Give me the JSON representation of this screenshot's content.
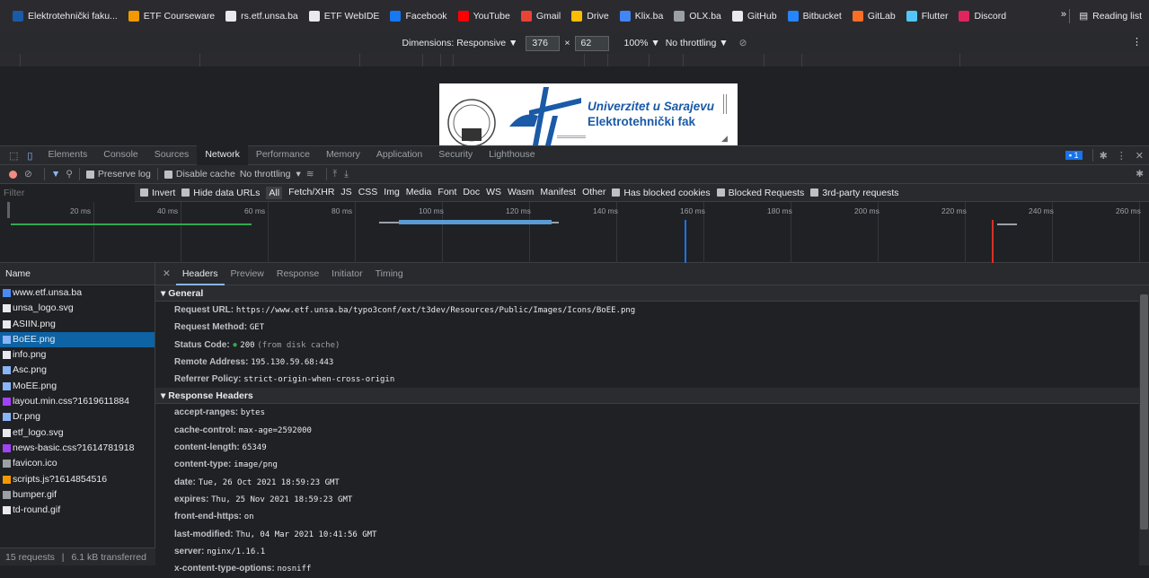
{
  "bookmarks": [
    {
      "label": "Elektrotehnički faku...",
      "color": "#1a5aa6"
    },
    {
      "label": "ETF Courseware",
      "color": "#f29900"
    },
    {
      "label": "rs.etf.unsa.ba",
      "color": "#e8eaed"
    },
    {
      "label": "ETF WebIDE",
      "color": "#e8eaed"
    },
    {
      "label": "Facebook",
      "color": "#1877f2"
    },
    {
      "label": "YouTube",
      "color": "#ff0000"
    },
    {
      "label": "Gmail",
      "color": "#ea4335"
    },
    {
      "label": "Drive",
      "color": "#fbbc04"
    },
    {
      "label": "Klix.ba",
      "color": "#4285f4"
    },
    {
      "label": "OLX.ba",
      "color": "#9aa0a6"
    },
    {
      "label": "GitHub",
      "color": "#e8eaed"
    },
    {
      "label": "Bitbucket",
      "color": "#2684ff"
    },
    {
      "label": "GitLab",
      "color": "#fc6d26"
    },
    {
      "label": "Flutter",
      "color": "#54c5f8"
    },
    {
      "label": "Discord",
      "color": "#e0245e"
    }
  ],
  "overflow": "»",
  "reading_list": "Reading list",
  "device": {
    "dimensions": "Dimensions: Responsive ▼",
    "width": "376",
    "times": "×",
    "height": "62",
    "zoom": "100% ▼",
    "throttle": "No throttling ▼"
  },
  "page": {
    "line1": "Univerzitet u Sarajevu",
    "line2": "Elektrotehnički fak"
  },
  "devtools_tabs": [
    "Elements",
    "Console",
    "Sources",
    "Network",
    "Performance",
    "Memory",
    "Application",
    "Security",
    "Lighthouse"
  ],
  "issues_count": "1",
  "toolbar": {
    "preserve_log": "Preserve log",
    "disable_cache": "Disable cache",
    "throttling": "No throttling"
  },
  "filter": {
    "placeholder": "Filter",
    "invert": "Invert",
    "hide_data": "Hide data URLs",
    "types": [
      "All",
      "Fetch/XHR",
      "JS",
      "CSS",
      "Img",
      "Media",
      "Font",
      "Doc",
      "WS",
      "Wasm",
      "Manifest",
      "Other"
    ],
    "blocked_cookies": "Has blocked cookies",
    "blocked_requests": "Blocked Requests",
    "third_party": "3rd-party requests"
  },
  "timeline_ticks": [
    "20 ms",
    "40 ms",
    "60 ms",
    "80 ms",
    "100 ms",
    "120 ms",
    "140 ms",
    "160 ms",
    "180 ms",
    "200 ms",
    "220 ms",
    "240 ms",
    "260 ms"
  ],
  "list": {
    "header": "Name",
    "items": [
      {
        "name": "www.etf.unsa.ba",
        "color": "#4a8af4"
      },
      {
        "name": "unsa_logo.svg",
        "color": "#e8eaed"
      },
      {
        "name": "ASIIN.png",
        "color": "#e8eaed"
      },
      {
        "name": "BoEE.png",
        "color": "#8ab4f8"
      },
      {
        "name": "info.png",
        "color": "#e8eaed"
      },
      {
        "name": "Asc.png",
        "color": "#8ab4f8"
      },
      {
        "name": "MoEE.png",
        "color": "#8ab4f8"
      },
      {
        "name": "layout.min.css?1619611884",
        "color": "#a142f4"
      },
      {
        "name": "Dr.png",
        "color": "#8ab4f8"
      },
      {
        "name": "etf_logo.svg",
        "color": "#e8eaed"
      },
      {
        "name": "news-basic.css?1614781918",
        "color": "#a142f4"
      },
      {
        "name": "favicon.ico",
        "color": "#9aa0a6"
      },
      {
        "name": "scripts.js?1614854516",
        "color": "#f29900"
      },
      {
        "name": "bumper.gif",
        "color": "#9aa0a6"
      },
      {
        "name": "td-round.gif",
        "color": "#e8eaed"
      }
    ],
    "footer_requests": "15 requests",
    "footer_transferred": "6.1 kB transferred"
  },
  "detail_tabs": [
    "Headers",
    "Preview",
    "Response",
    "Initiator",
    "Timing"
  ],
  "general": {
    "title": "General",
    "rows": [
      {
        "k": "Request URL:",
        "v": "https://www.etf.unsa.ba/typo3conf/ext/t3dev/Resources/Public/Images/Icons/BoEE.png"
      },
      {
        "k": "Request Method:",
        "v": "GET"
      },
      {
        "k": "Status Code:",
        "v": "200",
        "extra": "(from disk cache)"
      },
      {
        "k": "Remote Address:",
        "v": "195.130.59.68:443"
      },
      {
        "k": "Referrer Policy:",
        "v": "strict-origin-when-cross-origin"
      }
    ]
  },
  "response": {
    "title": "Response Headers",
    "rows": [
      {
        "k": "accept-ranges:",
        "v": "bytes"
      },
      {
        "k": "cache-control:",
        "v": "max-age=2592000"
      },
      {
        "k": "content-length:",
        "v": "65349"
      },
      {
        "k": "content-type:",
        "v": "image/png"
      },
      {
        "k": "date:",
        "v": "Tue, 26 Oct 2021 18:59:23 GMT"
      },
      {
        "k": "expires:",
        "v": "Thu, 25 Nov 2021 18:59:23 GMT"
      },
      {
        "k": "front-end-https:",
        "v": "on"
      },
      {
        "k": "last-modified:",
        "v": "Thu, 04 Mar 2021 10:41:56 GMT"
      },
      {
        "k": "server:",
        "v": "nginx/1.16.1"
      },
      {
        "k": "x-content-type-options:",
        "v": "nosniff"
      }
    ]
  }
}
